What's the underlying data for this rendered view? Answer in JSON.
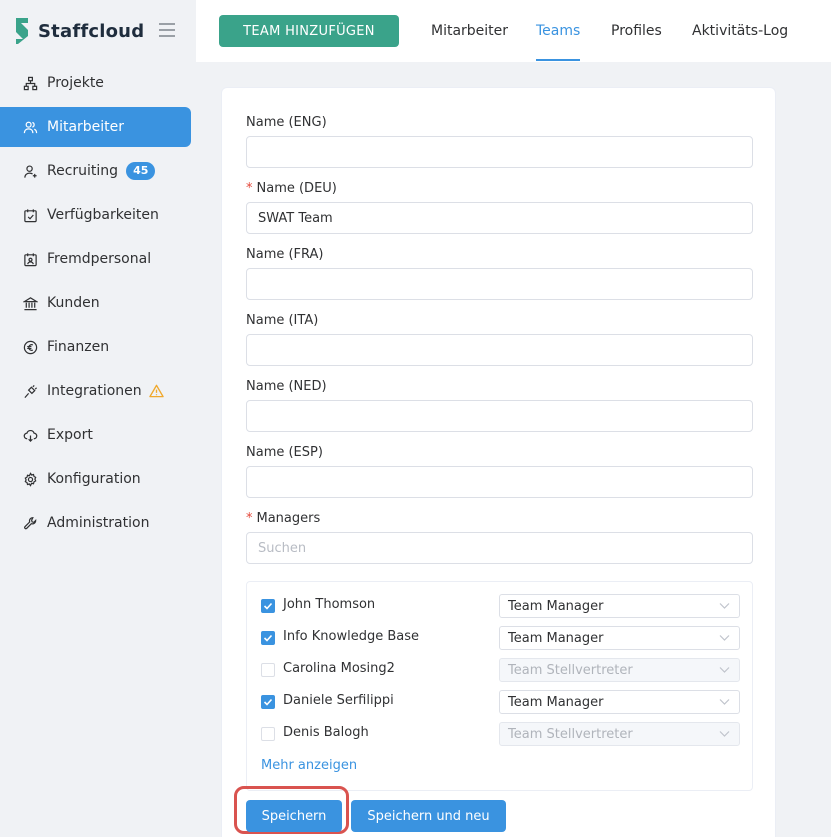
{
  "brand": {
    "name": "Staffcloud",
    "logo_color": "#3aa38a"
  },
  "sidebar": {
    "items": [
      {
        "label": "Projekte",
        "icon": "sitemap-icon"
      },
      {
        "label": "Mitarbeiter",
        "icon": "users-icon",
        "active": true
      },
      {
        "label": "Recruiting",
        "icon": "user-plus-icon",
        "badge": "45"
      },
      {
        "label": "Verfügbarkeiten",
        "icon": "calendar-check-icon"
      },
      {
        "label": "Fremdpersonal",
        "icon": "id-card-icon"
      },
      {
        "label": "Kunden",
        "icon": "bank-icon"
      },
      {
        "label": "Finanzen",
        "icon": "euro-icon"
      },
      {
        "label": "Integrationen",
        "icon": "plug-icon",
        "warning": true
      },
      {
        "label": "Export",
        "icon": "cloud-download-icon"
      },
      {
        "label": "Konfiguration",
        "icon": "gear-icon"
      },
      {
        "label": "Administration",
        "icon": "wrench-icon"
      }
    ]
  },
  "topbar": {
    "add_button": "TEAM HINZUFÜGEN",
    "tabs": [
      {
        "label": "Mitarbeiter"
      },
      {
        "label": "Teams",
        "active": true
      },
      {
        "label": "Profiles"
      },
      {
        "label": "Aktivitäts-Log"
      }
    ]
  },
  "form": {
    "fields": [
      {
        "label": "Name (ENG)",
        "value": "",
        "required": false
      },
      {
        "label": "Name (DEU)",
        "value": "SWAT Team",
        "required": true
      },
      {
        "label": "Name (FRA)",
        "value": "",
        "required": false
      },
      {
        "label": "Name (ITA)",
        "value": "",
        "required": false
      },
      {
        "label": "Name (NED)",
        "value": "",
        "required": false
      },
      {
        "label": "Name (ESP)",
        "value": "",
        "required": false
      }
    ],
    "managers_label": "Managers",
    "managers_placeholder": "Suchen",
    "managers": [
      {
        "name": "John Thomson",
        "checked": true,
        "role": "Team Manager"
      },
      {
        "name": "Info Knowledge Base",
        "checked": true,
        "role": "Team Manager"
      },
      {
        "name": "Carolina Mosing2",
        "checked": false,
        "role": "Team Stellvertreter"
      },
      {
        "name": "Daniele Serfilippi",
        "checked": true,
        "role": "Team Manager"
      },
      {
        "name": "Denis Balogh",
        "checked": false,
        "role": "Team Stellvertreter"
      }
    ],
    "more_link": "Mehr anzeigen",
    "save_label": "Speichern",
    "save_new_label": "Speichern und neu"
  },
  "colors": {
    "accent": "#3a93e0",
    "brand": "#3aa38a",
    "highlight": "#d9534f",
    "required": "#e4473a",
    "warning": "#f0a82c"
  }
}
